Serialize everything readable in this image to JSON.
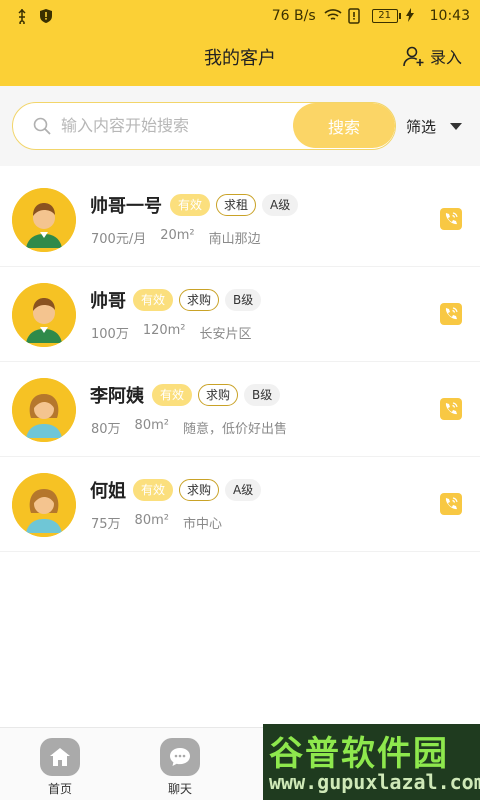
{
  "status_bar": {
    "network_speed": "76 B/s",
    "battery": "21",
    "time": "10:43"
  },
  "header": {
    "title": "我的客户",
    "action_label": "录入"
  },
  "search": {
    "placeholder": "输入内容开始搜索",
    "button_label": "搜索",
    "filter_label": "筛选"
  },
  "customers": [
    {
      "name": "帅哥一号",
      "valid_tag": "有效",
      "type_tag": "求租",
      "level_tag": "A级",
      "price": "700元/月",
      "area": "20m²",
      "note": "南山那边",
      "gender": "male"
    },
    {
      "name": "帅哥",
      "valid_tag": "有效",
      "type_tag": "求购",
      "level_tag": "B级",
      "price": "100万",
      "area": "120m²",
      "note": "长安片区",
      "gender": "male"
    },
    {
      "name": "李阿姨",
      "valid_tag": "有效",
      "type_tag": "求购",
      "level_tag": "B级",
      "price": "80万",
      "area": "80m²",
      "note": "随意，低价好出售",
      "gender": "female"
    },
    {
      "name": "何姐",
      "valid_tag": "有效",
      "type_tag": "求购",
      "level_tag": "A级",
      "price": "75万",
      "area": "80m²",
      "note": "市中心",
      "gender": "female"
    }
  ],
  "bottom_nav": {
    "home_label": "首页",
    "chat_label": "聊天"
  },
  "watermark": {
    "title": "谷普软件园",
    "url": "www.gupuxlazal.com"
  },
  "colors": {
    "accent": "#fbd036",
    "tag_valid": "#fbdf7d",
    "call_icon": "#f8c843"
  }
}
